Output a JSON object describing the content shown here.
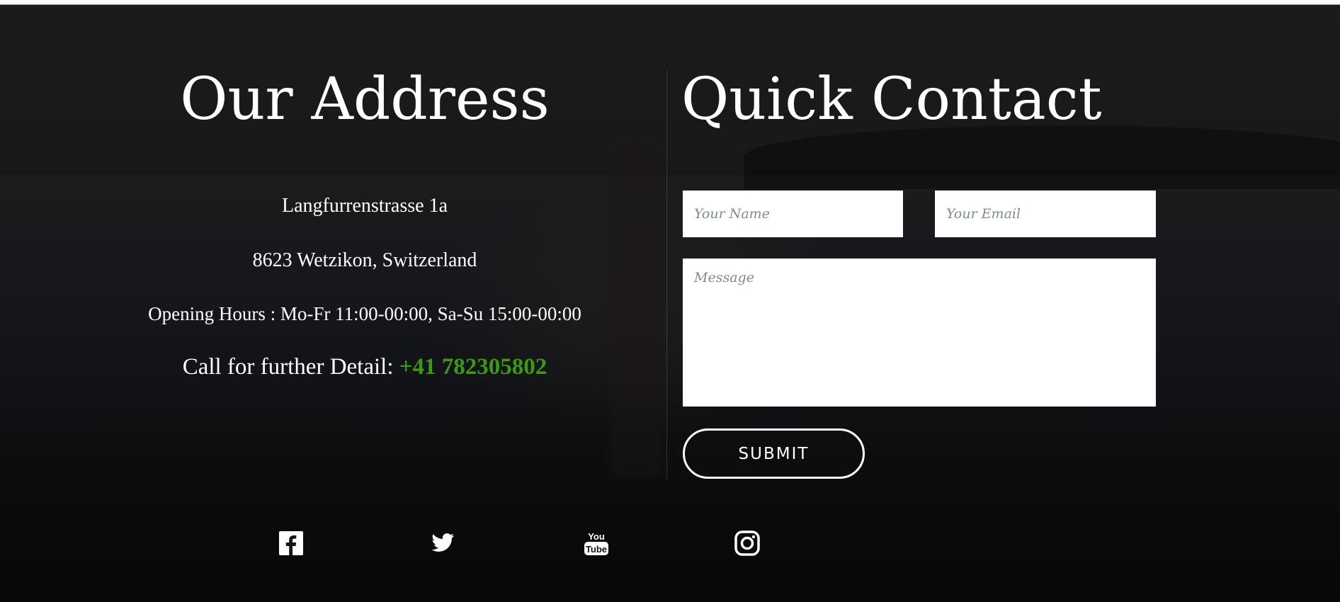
{
  "address": {
    "title": "Our Address",
    "street": "Langfurrenstrasse 1a",
    "city": "8623 Wetzikon, Switzerland",
    "hours": "Opening Hours : Mo-Fr 11:00-00:00, Sa-Su 15:00-00:00",
    "call_label": "Call for further Detail: ",
    "phone": "+41 782305802"
  },
  "contact": {
    "title": "Quick Contact",
    "name_placeholder": "Your Name",
    "email_placeholder": "Your Email",
    "message_placeholder": "Message",
    "submit_label": "SUBMIT"
  },
  "social": [
    {
      "icon": "facebook-icon"
    },
    {
      "icon": "twitter-icon"
    },
    {
      "icon": "youtube-icon"
    },
    {
      "icon": "instagram-icon"
    }
  ],
  "colors": {
    "background": "#161616",
    "text": "#ffffff",
    "phone_accent": "#3b9a12",
    "placeholder": "#7f8a96"
  }
}
